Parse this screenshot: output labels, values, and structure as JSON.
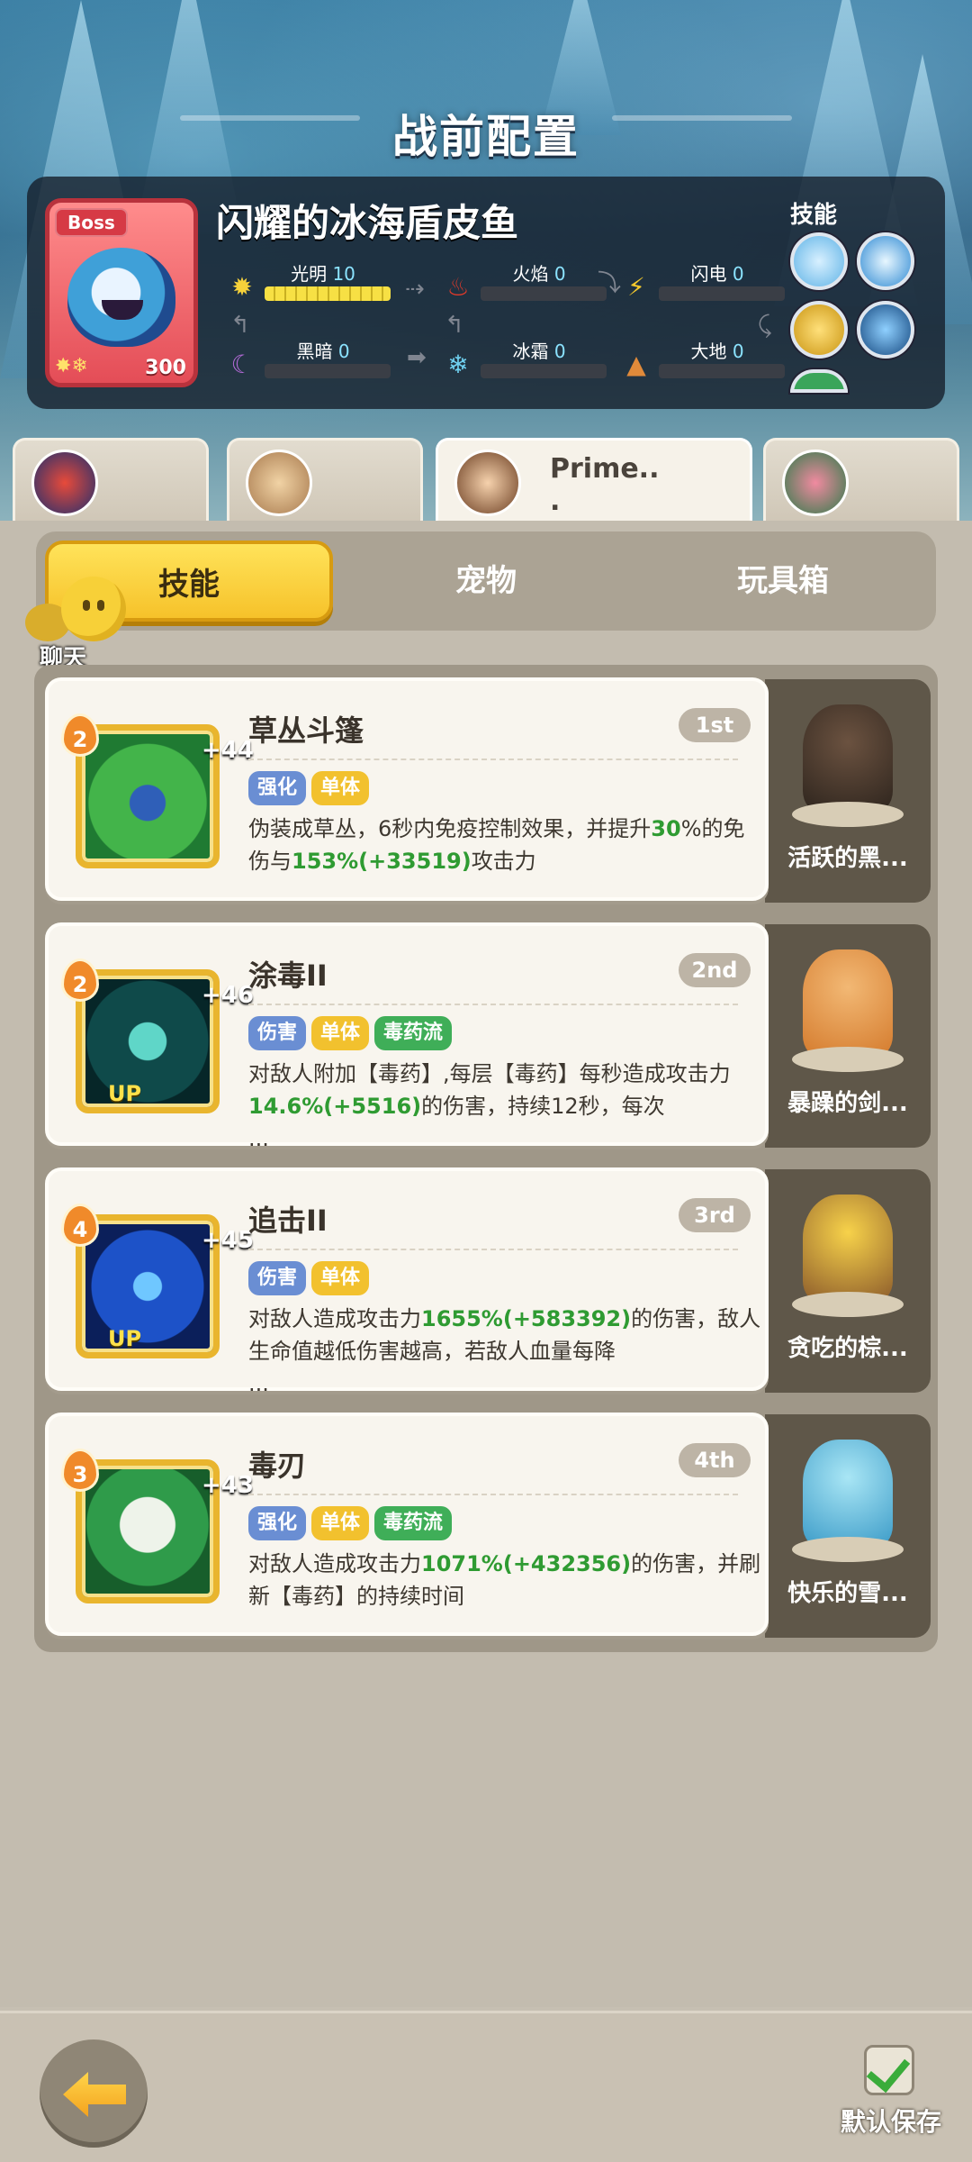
{
  "header": {
    "title": "战前配置"
  },
  "boss": {
    "tag": "Boss",
    "name": "闪耀的冰海盾皮鱼",
    "level": "300",
    "elements_glyph": "✸❄",
    "skills_label": "技能",
    "stats": [
      {
        "label": "光明",
        "value": "10",
        "icon": "sun-icon",
        "fill": 1.0
      },
      {
        "label": "火焰",
        "value": "0",
        "icon": "fire-icon",
        "fill": 0
      },
      {
        "label": "闪电",
        "value": "0",
        "icon": "lightning-icon",
        "fill": 0
      },
      {
        "label": "黑暗",
        "value": "0",
        "icon": "moon-icon",
        "fill": 0
      },
      {
        "label": "冰霜",
        "value": "0",
        "icon": "snowflake-icon",
        "fill": 0
      },
      {
        "label": "大地",
        "value": "0",
        "icon": "mountain-icon",
        "fill": 0
      }
    ]
  },
  "characters": [
    {
      "name": ""
    },
    {
      "name": ""
    },
    {
      "name": "Prime..\n."
    },
    {
      "name": ""
    }
  ],
  "tabs": [
    "技能",
    "宠物",
    "玩具箱"
  ],
  "chat": {
    "label": "聊天"
  },
  "skills": [
    {
      "title": "草丛斗篷",
      "rank": "1st",
      "level": "2",
      "plus": "+44",
      "up": "",
      "tags": [
        {
          "text": "强化",
          "color": "blue"
        },
        {
          "text": "单体",
          "color": "yellow"
        }
      ],
      "desc_parts": [
        "伪装成草丛，6秒内免疫控制效果，并提升",
        "30",
        "%的免伤与",
        "153%(+33519)",
        "攻击力"
      ],
      "pet": "活跃的黑..."
    },
    {
      "title": "涂毒II",
      "rank": "2nd",
      "level": "2",
      "plus": "+46",
      "up": "UP",
      "tags": [
        {
          "text": "伤害",
          "color": "blue"
        },
        {
          "text": "单体",
          "color": "yellow"
        },
        {
          "text": "毒药流",
          "color": "green"
        }
      ],
      "desc_parts": [
        "对敌人附加【毒药】,每层【毒药】每秒造成攻击力",
        "14.6%(+5516)",
        "的伤害，持续12秒，每次",
        "",
        "..."
      ],
      "pet": "暴躁的剑..."
    },
    {
      "title": "追击II",
      "rank": "3rd",
      "level": "4",
      "plus": "+45",
      "up": "UP",
      "tags": [
        {
          "text": "伤害",
          "color": "blue"
        },
        {
          "text": "单体",
          "color": "yellow"
        }
      ],
      "desc_parts": [
        "对敌人造成攻击力",
        "1655%(+583392)",
        "的伤害，敌人生命值越低伤害越高，若敌人血量每降",
        "",
        "..."
      ],
      "pet": "贪吃的棕..."
    },
    {
      "title": "毒刃",
      "rank": "4th",
      "level": "3",
      "plus": "+43",
      "up": "",
      "tags": [
        {
          "text": "强化",
          "color": "blue"
        },
        {
          "text": "单体",
          "color": "yellow"
        },
        {
          "text": "毒药流",
          "color": "green"
        }
      ],
      "desc_parts": [
        "对敌人造成攻击力",
        "1071%(+432356)",
        "的伤害，并刷新【毒药】的持续时间",
        "",
        ""
      ],
      "pet": "快乐的雪..."
    }
  ],
  "footer": {
    "save_label": "默认保存"
  }
}
